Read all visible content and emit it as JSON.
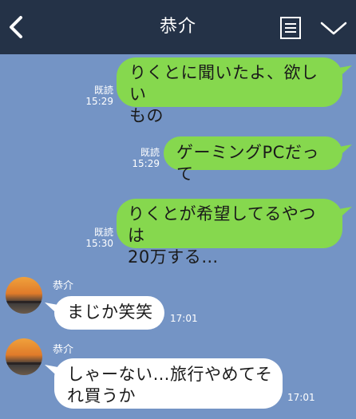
{
  "header": {
    "title": "恭介",
    "back_icon": "chevron-left-icon",
    "notes_icon": "notes-icon",
    "menu_icon": "chevron-down-icon"
  },
  "colors": {
    "background": "#7494c5",
    "header": "#243247",
    "sent_bubble": "#86d84e",
    "received_bubble": "#ffffff"
  },
  "messages": [
    {
      "direction": "sent",
      "lines": [
        "りくとに聞いたよ、欲しい",
        "もの"
      ],
      "read": "既読",
      "time": "15:29"
    },
    {
      "direction": "sent",
      "lines": [
        "ゲーミングPCだって"
      ],
      "read": "既読",
      "time": "15:29"
    },
    {
      "direction": "sent",
      "lines": [
        "りくとが希望してるやつは",
        "20万する…"
      ],
      "read": "既読",
      "time": "15:30"
    },
    {
      "direction": "received",
      "sender": "恭介",
      "lines": [
        "まじか笑笑"
      ],
      "time": "17:01"
    },
    {
      "direction": "received",
      "sender": "恭介",
      "lines": [
        "しゃーない…旅行やめてそ",
        "れ買うか"
      ],
      "time": "17:01"
    }
  ]
}
